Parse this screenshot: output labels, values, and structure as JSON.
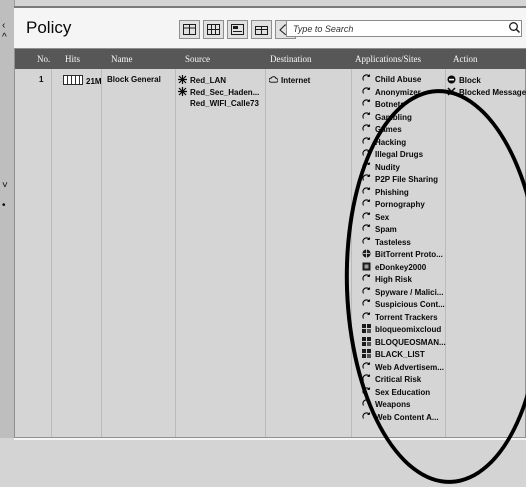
{
  "title": "Policy",
  "search": {
    "placeholder": "Type to Search"
  },
  "toolbar": {
    "icons": [
      "layout-icon",
      "columns-icon",
      "filter-icon",
      "columns-hide-icon",
      "tag-icon"
    ]
  },
  "table": {
    "headers": {
      "no": "No.",
      "hits": "Hits",
      "name": "Name",
      "source": "Source",
      "destination": "Destination",
      "apps": "Applications/Sites",
      "action": "Action"
    },
    "row": {
      "no": "1",
      "hits": "21M",
      "name": "Block General",
      "sources": [
        "Red_LAN",
        "Red_Sec_Haden...",
        "Red_WIFI_Calle73"
      ],
      "destination": "Internet",
      "actions": [
        "Block",
        "Blocked Message"
      ],
      "apps": [
        {
          "label": "Child Abuse",
          "icon": "category-icon"
        },
        {
          "label": "Anonymizer",
          "icon": "category-icon"
        },
        {
          "label": "Botnets",
          "icon": "category-icon"
        },
        {
          "label": "Gambling",
          "icon": "category-icon"
        },
        {
          "label": "Games",
          "icon": "category-icon"
        },
        {
          "label": "Hacking",
          "icon": "category-icon"
        },
        {
          "label": "Illegal Drugs",
          "icon": "category-icon"
        },
        {
          "label": "Nudity",
          "icon": "category-icon"
        },
        {
          "label": "P2P File Sharing",
          "icon": "category-icon"
        },
        {
          "label": "Phishing",
          "icon": "category-icon"
        },
        {
          "label": "Pornography",
          "icon": "category-icon"
        },
        {
          "label": "Sex",
          "icon": "category-icon"
        },
        {
          "label": "Spam",
          "icon": "category-icon"
        },
        {
          "label": "Tasteless",
          "icon": "category-icon"
        },
        {
          "label": "BitTorrent Proto...",
          "icon": "app-globe-icon"
        },
        {
          "label": "eDonkey2000",
          "icon": "app-square-icon"
        },
        {
          "label": "High Risk",
          "icon": "category-icon"
        },
        {
          "label": "Spyware / Malici...",
          "icon": "category-icon"
        },
        {
          "label": "Suspicious Cont...",
          "icon": "category-icon"
        },
        {
          "label": "Torrent Trackers",
          "icon": "category-icon"
        },
        {
          "label": "bloqueomixcloud",
          "icon": "group-icon"
        },
        {
          "label": "BLOQUEOSMAN...",
          "icon": "group-icon"
        },
        {
          "label": "BLACK_LIST",
          "icon": "group-icon"
        },
        {
          "label": "Web Advertisem...",
          "icon": "category-icon"
        },
        {
          "label": "Critical Risk",
          "icon": "category-icon"
        },
        {
          "label": "Sex Education",
          "icon": "category-icon"
        },
        {
          "label": "Weapons",
          "icon": "category-icon"
        },
        {
          "label": "Web Content A...",
          "icon": "category-icon"
        }
      ]
    }
  }
}
